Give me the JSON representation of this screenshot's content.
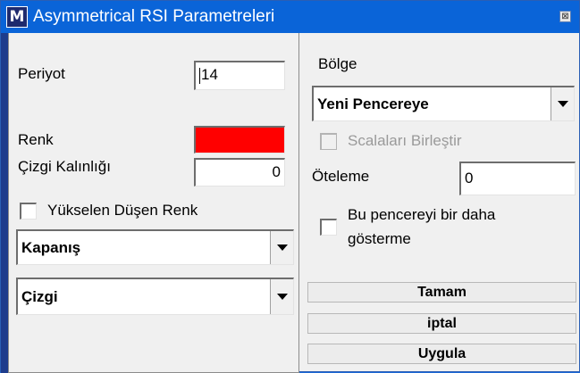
{
  "window": {
    "title": "Asymmetrical RSI Parametreleri",
    "app_icon_letter": "M",
    "close_glyph": "⊠"
  },
  "left": {
    "period_label": "Periyot",
    "period_value": "14",
    "color_label": "Renk",
    "color_value": "#ff0000",
    "line_width_label": "Çizgi Kalınlığı",
    "line_width_value": "0",
    "rise_fall_color_label": "Yükselen Düşen Renk",
    "rise_fall_color_checked": false,
    "source_select": "Kapanış",
    "style_select": "Çizgi"
  },
  "right": {
    "region_label": "Bölge",
    "region_select": "Yeni Pencereye",
    "merge_scales_label": "Scalaları Birleştir",
    "merge_scales_enabled": false,
    "offset_label": "Öteleme",
    "offset_value": "0",
    "dont_show_label_line1": "Bu pencereyi bir daha",
    "dont_show_label_line2": "gösterme",
    "dont_show_checked": false
  },
  "buttons": {
    "ok": "Tamam",
    "cancel": "iptal",
    "apply": "Uygula"
  },
  "icons": {
    "dropdown": "chevron-down-icon",
    "close": "close-icon"
  },
  "colors": {
    "titlebar": "#0a64d8",
    "window_bg": "#f0f0f0",
    "accent_red": "#ff0000"
  }
}
